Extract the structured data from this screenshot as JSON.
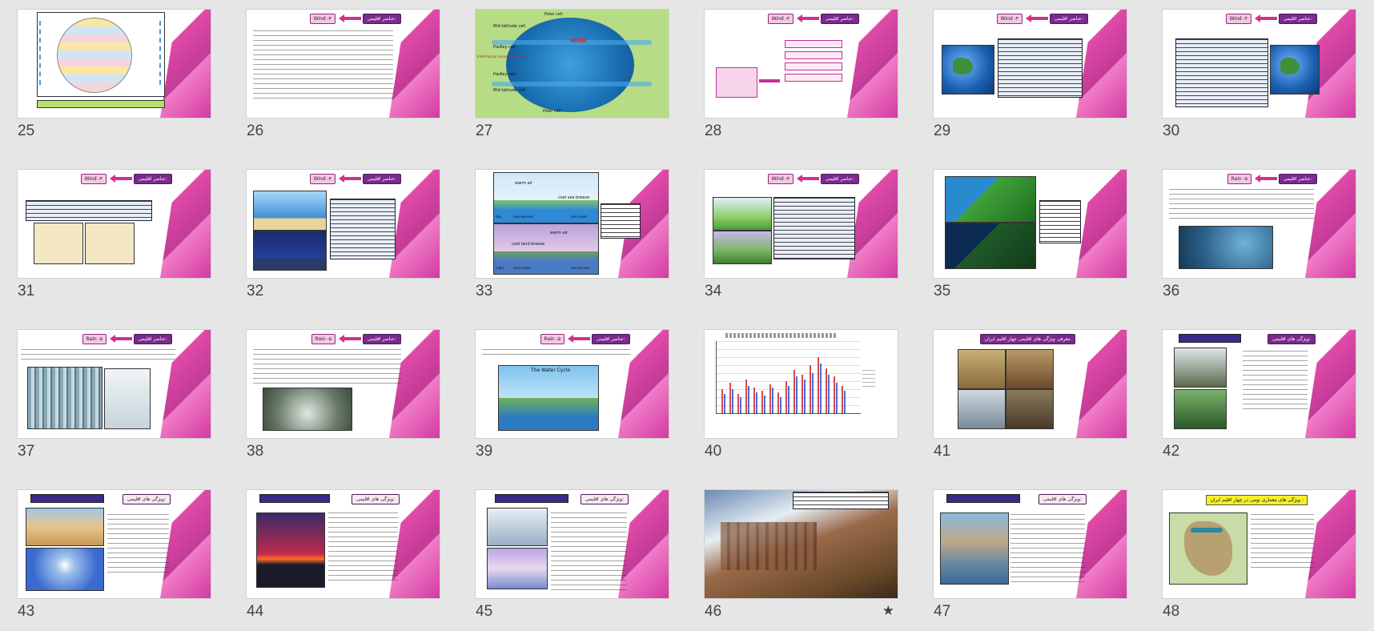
{
  "slides": [
    {
      "num": "25",
      "wind": "",
      "title": ""
    },
    {
      "num": "26",
      "wind": "Wind -۴",
      "title": "عناصر اقلیمی:"
    },
    {
      "num": "27",
      "labels": [
        "Polar cell",
        "Mid-latitude cell",
        "HIGH",
        "Hadley cell",
        "Intertropical convergence zone",
        "Hadley cell",
        "Mid-latitude cell",
        "Polar cell"
      ]
    },
    {
      "num": "28",
      "wind": "Wind -۴",
      "title": "عناصر اقلیمی:"
    },
    {
      "num": "29",
      "wind": "Wind -۴",
      "title": "عناصر اقلیمی:"
    },
    {
      "num": "30",
      "wind": "Wind -۴",
      "title": "عناصر اقلیمی:"
    },
    {
      "num": "31",
      "wind": "Wind -۴",
      "title": "عناصر اقلیمی:"
    },
    {
      "num": "32",
      "wind": "Wind -۴",
      "title": "عناصر اقلیمی:"
    },
    {
      "num": "33",
      "labels": [
        "warm air",
        "cool sea breeze",
        "land warmer",
        "sea cooler",
        "day",
        "cool land breeze",
        "warm air",
        "land cooler",
        "sea warmer",
        "night"
      ]
    },
    {
      "num": "34",
      "wind": "Wind -۴",
      "title": "عناصر اقلیمی:"
    },
    {
      "num": "35"
    },
    {
      "num": "36",
      "wind": "Rain -۵",
      "title": "عناصر اقلیمی:"
    },
    {
      "num": "37",
      "wind": "Rain -۵",
      "title": "عناصر اقلیمی:"
    },
    {
      "num": "38",
      "wind": "Rain -۵",
      "title": "عناصر اقلیمی:"
    },
    {
      "num": "39",
      "wind": "Rain -۵",
      "title": "عناصر اقلیمی:",
      "labels": [
        "The Water Cycle"
      ]
    },
    {
      "num": "40"
    },
    {
      "num": "41",
      "title": "معرفی ویژگی های اقلیمی چهار اقلیم ایران"
    },
    {
      "num": "42",
      "title": "ویژگی های اقلیمی:"
    },
    {
      "num": "43",
      "title": "ویژگی های اقلیمی:"
    },
    {
      "num": "44",
      "title": "ویژگی های اقلیمی:"
    },
    {
      "num": "45",
      "title": "ویژگی های اقلیمی:"
    },
    {
      "num": "46",
      "star": "★"
    },
    {
      "num": "47",
      "title": "ویژگی های اقلیمی:"
    },
    {
      "num": "48",
      "title": "ویژگی های معماری بومی در چهار اقلیم ایران :"
    }
  ]
}
